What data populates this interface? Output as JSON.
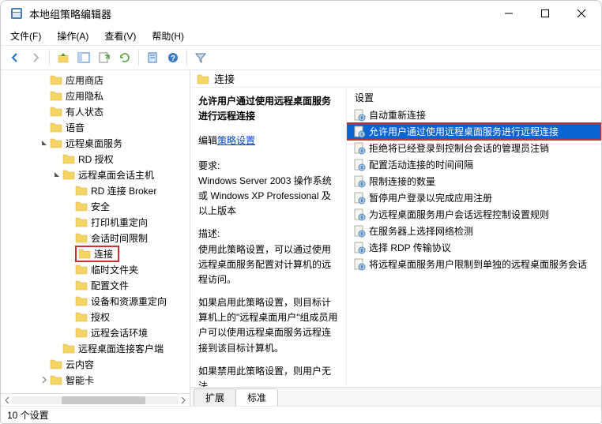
{
  "window": {
    "title": "本地组策略编辑器"
  },
  "menubar": [
    "文件(F)",
    "操作(A)",
    "查看(V)",
    "帮助(H)"
  ],
  "tree": [
    {
      "level": 3,
      "chevron": null,
      "label": "应用商店"
    },
    {
      "level": 3,
      "chevron": null,
      "label": "应用隐私"
    },
    {
      "level": 3,
      "chevron": null,
      "label": "有人状态"
    },
    {
      "level": 3,
      "chevron": null,
      "label": "语音"
    },
    {
      "level": 3,
      "chevron": "open",
      "label": "远程桌面服务"
    },
    {
      "level": 4,
      "chevron": null,
      "label": "RD 授权"
    },
    {
      "level": 4,
      "chevron": "open",
      "label": "远程桌面会话主机"
    },
    {
      "level": 5,
      "chevron": null,
      "label": "RD 连接 Broker"
    },
    {
      "level": 5,
      "chevron": null,
      "label": "安全"
    },
    {
      "level": 5,
      "chevron": null,
      "label": "打印机重定向"
    },
    {
      "level": 5,
      "chevron": null,
      "label": "会话时间限制"
    },
    {
      "level": 5,
      "chevron": null,
      "label": "连接",
      "highlighted": true
    },
    {
      "level": 5,
      "chevron": null,
      "label": "临时文件夹"
    },
    {
      "level": 5,
      "chevron": null,
      "label": "配置文件"
    },
    {
      "level": 5,
      "chevron": null,
      "label": "设备和资源重定向"
    },
    {
      "level": 5,
      "chevron": null,
      "label": "授权"
    },
    {
      "level": 5,
      "chevron": null,
      "label": "远程会话环境"
    },
    {
      "level": 4,
      "chevron": null,
      "label": "远程桌面连接客户端"
    },
    {
      "level": 3,
      "chevron": null,
      "label": "云内容"
    },
    {
      "level": 3,
      "chevron": "closed",
      "label": "智能卡"
    }
  ],
  "detail": {
    "header": "连接",
    "title": "允许用户通过使用远程桌面服务进行远程连接",
    "edit_prefix": "编辑",
    "edit_link": "策略设置",
    "req_label": "要求:",
    "req_text": "Windows Server 2003 操作系统或 Windows XP Professional 及以上版本",
    "desc_label": "描述:",
    "desc1": "使用此策略设置，可以通过使用远程桌面服务配置对计算机的远程访问。",
    "desc2": "如果启用此策略设置，则目标计算机上的\"远程桌面用户\"组成员用户可以使用远程桌面服务远程连接到该目标计算机。",
    "desc3": "如果禁用此策略设置，则用户无法"
  },
  "settings": {
    "column": "设置",
    "items": [
      {
        "label": "自动重新连接",
        "selected": false
      },
      {
        "label": "允许用户通过使用远程桌面服务进行远程连接",
        "selected": true,
        "boxed": true
      },
      {
        "label": "拒绝将已经登录到控制台会话的管理员注销",
        "selected": false
      },
      {
        "label": "配置活动连接的时间间隔",
        "selected": false
      },
      {
        "label": "限制连接的数量",
        "selected": false
      },
      {
        "label": "暂停用户登录以完成应用注册",
        "selected": false
      },
      {
        "label": "为远程桌面服务用户会话远程控制设置规则",
        "selected": false
      },
      {
        "label": "在服务器上选择网络检测",
        "selected": false
      },
      {
        "label": "选择 RDP 传输协议",
        "selected": false
      },
      {
        "label": "将远程桌面服务用户限制到单独的远程桌面服务会话",
        "selected": false
      }
    ]
  },
  "tabs": [
    "扩展",
    "标准"
  ],
  "status": "10 个设置"
}
